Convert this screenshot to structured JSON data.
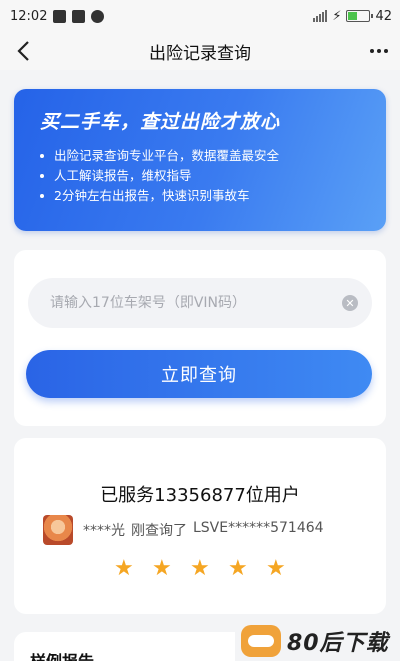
{
  "status_bar": {
    "time": "12:02",
    "battery_level": "42"
  },
  "nav": {
    "title": "出险记录查询"
  },
  "banner": {
    "title": "买二手车，查过出险才放心",
    "bullets": [
      "出险记录查询专业平台，数据覆盖最安全",
      "人工解读报告，维权指导",
      "2分钟左右出报告，快速识别事故车"
    ]
  },
  "query": {
    "placeholder": "请输入17位车架号（即VIN码）",
    "value": "",
    "button_label": "立即查询"
  },
  "served": {
    "title": "已服务13356877位用户",
    "user": "****光",
    "action": "刚查询了",
    "vin": "LSVE******571464",
    "rating": 5
  },
  "sample": {
    "title": "样例报告"
  },
  "watermark": {
    "text": "80后下载"
  },
  "colors": {
    "accent": "#2a64e6",
    "star": "#f5a623"
  }
}
